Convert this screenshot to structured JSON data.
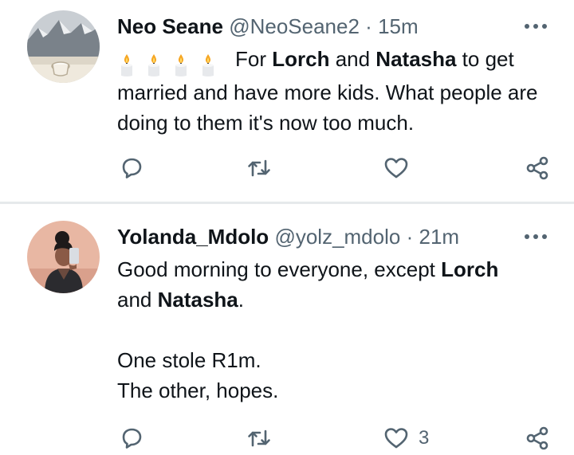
{
  "tweets": [
    {
      "name": "Neo Seane",
      "handle": "@NeoSeane2",
      "separator": "·",
      "time": "15m",
      "body": {
        "emoji": "🕯️🕯️🕯️🕯️",
        "t1": "For ",
        "b1": "Lorch",
        "t2": " and ",
        "b2": "Natasha",
        "t3": " to get married and have more kids. What people are doing to them it's  now too much."
      },
      "like_count": ""
    },
    {
      "name": "Yolanda_Mdolo",
      "handle": "@yolz_mdolo",
      "separator": "·",
      "time": "21m",
      "body": {
        "t1": "Good morning to everyone, except ",
        "b1": "Lorch",
        "t2": "and ",
        "b2": "Natasha",
        "t3": ".",
        "line3": "One stole R1m.",
        "line4": "The other,  hopes."
      },
      "like_count": "3"
    }
  ],
  "icons": [
    "avatar-photo",
    "more-icon",
    "reply-icon",
    "retweet-icon",
    "like-icon",
    "share-icon",
    "candle-emoji"
  ],
  "colors": {
    "text": "#0f1419",
    "secondary": "#536471",
    "divider": "#e6e9eb"
  }
}
